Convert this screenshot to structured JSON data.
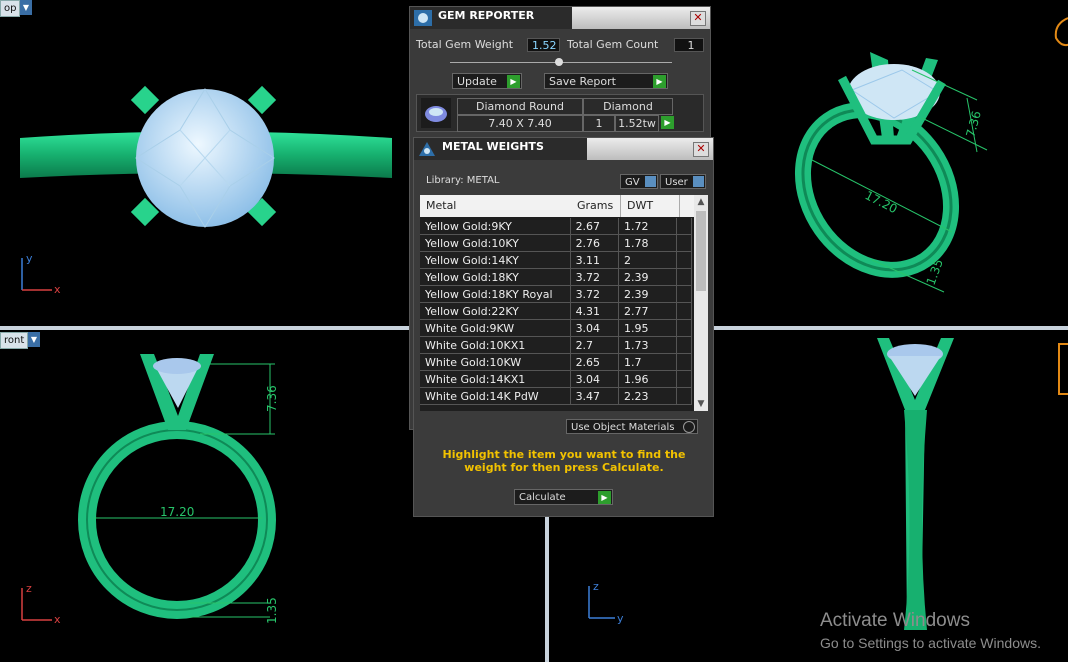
{
  "viewports": {
    "top_left_label": "op",
    "bottom_left_label": "ront",
    "dim_ring_size": "17.20",
    "dim_head_height": "7.36",
    "dim_shank_thickness": "1.35"
  },
  "axes": {
    "y": "y",
    "x": "x",
    "z": "z"
  },
  "gem_reporter": {
    "title": "GEM REPORTER",
    "close": "✕",
    "total_gem_weight_label": "Total Gem Weight",
    "total_gem_weight_value": "1.52",
    "total_gem_count_label": "Total Gem Count",
    "total_gem_count_value": "1",
    "update_label": "Update",
    "save_report_label": "Save Report",
    "gem_shape": "Diamond Round",
    "gem_type": "Diamond",
    "gem_size": "7.40 X 7.40",
    "gem_qty": "1",
    "gem_weight": "1.52tw"
  },
  "metal_weights": {
    "title": "METAL WEIGHTS",
    "close": "✕",
    "library_label": "Library: METAL",
    "gv_label": "GV",
    "user_label": "User",
    "columns": [
      "Metal",
      "Grams",
      "DWT"
    ],
    "rows": [
      [
        "Yellow Gold:9KY",
        "2.67",
        "1.72"
      ],
      [
        "Yellow Gold:10KY",
        "2.76",
        "1.78"
      ],
      [
        "Yellow Gold:14KY",
        "3.11",
        "2"
      ],
      [
        "Yellow Gold:18KY",
        "3.72",
        "2.39"
      ],
      [
        "Yellow Gold:18KY Royal",
        "3.72",
        "2.39"
      ],
      [
        "Yellow Gold:22KY",
        "4.31",
        "2.77"
      ],
      [
        "White Gold:9KW",
        "3.04",
        "1.95"
      ],
      [
        "White Gold:10KX1",
        "2.7",
        "1.73"
      ],
      [
        "White Gold:10KW",
        "2.65",
        "1.7"
      ],
      [
        "White Gold:14KX1",
        "3.04",
        "1.96"
      ],
      [
        "White Gold:14K PdW",
        "3.47",
        "2.23"
      ]
    ],
    "use_object_materials": "Use Object Materials",
    "hint": "Highlight the item you want to find the weight for then press Calculate.",
    "calculate_label": "Calculate"
  },
  "windows_watermark": {
    "line1": "Activate Windows",
    "line2": "Go to Settings to activate Windows."
  },
  "colors": {
    "ring": "#1fbf7e",
    "gem": "#cfe6f5",
    "dimension": "#27c46a",
    "accent_go": "#2d9e2d",
    "hint": "#f2c200"
  }
}
